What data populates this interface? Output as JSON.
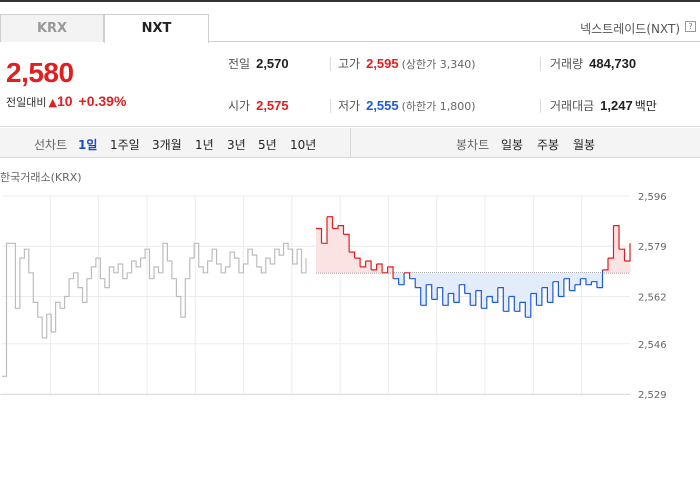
{
  "tabs": {
    "krx": "KRX",
    "nxt": "NXT"
  },
  "nxt_title": "넥스트레이드(NXT)",
  "help_icon_text": "?",
  "price": {
    "current": "2,580",
    "change_label": "전일대비",
    "change_icon": "up-triangle-icon",
    "change": "10",
    "change_pct": "+0.39%"
  },
  "stats": {
    "prev_close": {
      "label": "전일",
      "value": "2,570"
    },
    "high": {
      "label": "고가",
      "value": "2,595",
      "sub": "(상한가 3,340)"
    },
    "volume": {
      "label": "거래량",
      "value": "484,730"
    },
    "open": {
      "label": "시가",
      "value": "2,575"
    },
    "low": {
      "label": "저가",
      "value": "2,555",
      "sub": "(하한가 1,800)"
    },
    "amount": {
      "label": "거래대금",
      "value": "1,247",
      "unit": "백만"
    }
  },
  "period_bar": {
    "line_label": "선차트",
    "line_periods": [
      "1일",
      "1주일",
      "3개월",
      "1년",
      "3년",
      "5년",
      "10년"
    ],
    "active": "1일",
    "candle_label": "봉차트",
    "candle_periods": [
      "일봉",
      "주봉",
      "월봉"
    ]
  },
  "chart_caption": "한국거래소(KRX)",
  "colors": {
    "up": "#e02020",
    "down": "#1f5bd6",
    "krx_line": "#bdbdbd",
    "up_fill": "#fbe3e3",
    "down_fill": "#e3ecfb"
  },
  "chart_data": {
    "type": "line",
    "title": "",
    "ylim": [
      2529,
      2596
    ],
    "yticks": [
      "2,596",
      "2,579",
      "2,562",
      "2,546",
      "2,529"
    ],
    "ytick_values": [
      2596,
      2579,
      2562,
      2546,
      2529
    ],
    "reference_price": 2570,
    "grid": true,
    "series": [
      {
        "name": "한국거래소(KRX)",
        "values": [
          2535,
          2580,
          2580,
          2558,
          2575,
          2578,
          2570,
          2560,
          2555,
          2548,
          2556,
          2550,
          2560,
          2558,
          2562,
          2568,
          2570,
          2565,
          2560,
          2568,
          2572,
          2575,
          2568,
          2565,
          2572,
          2570,
          2573,
          2568,
          2570,
          2574,
          2572,
          2575,
          2578,
          2568,
          2572,
          2570,
          2580,
          2574,
          2568,
          2562,
          2555,
          2568,
          2575,
          2580,
          2572,
          2570,
          2574,
          2578,
          2573,
          2570,
          2572,
          2577,
          2575,
          2570,
          2573,
          2578,
          2576,
          2572,
          2570,
          2575,
          2573,
          2578,
          2576,
          2580,
          2578,
          2573,
          2578,
          2570,
          2575
        ]
      },
      {
        "name": "NXT",
        "values": [
          2585,
          2580,
          2589,
          2585,
          2586,
          2583,
          2577,
          2575,
          2572,
          2574,
          2571,
          2573,
          2570,
          2572,
          2568,
          2566,
          2570,
          2568,
          2565,
          2559,
          2566,
          2561,
          2565,
          2559,
          2563,
          2560,
          2566,
          2563,
          2559,
          2564,
          2558,
          2562,
          2560,
          2565,
          2557,
          2562,
          2557,
          2560,
          2555,
          2563,
          2559,
          2565,
          2560,
          2567,
          2562,
          2568,
          2564,
          2566,
          2568,
          2566,
          2567,
          2565,
          2571,
          2575,
          2586,
          2578,
          2574,
          2580
        ]
      }
    ]
  }
}
